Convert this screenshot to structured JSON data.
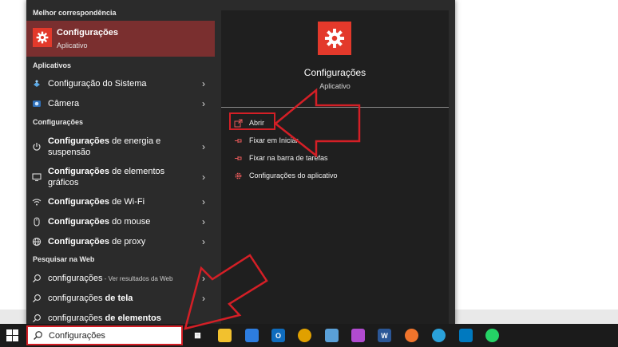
{
  "search_panel": {
    "best_match_label": "Melhor correspondência",
    "best_match": {
      "title": "Configurações",
      "subtitle": "Aplicativo",
      "icon": "gear-icon"
    },
    "apps_label": "Aplicativos",
    "apps": [
      {
        "label": "Configuração do Sistema",
        "icon": "system-config-icon"
      },
      {
        "label": "Câmera",
        "icon": "camera-icon"
      }
    ],
    "settings_label": "Configurações",
    "settings": [
      {
        "bold": "Configurações",
        "rest": " de energia e",
        "line2": "suspensão",
        "icon": "power-icon"
      },
      {
        "bold": "Configurações",
        "rest": " de elementos",
        "line2": "gráficos",
        "icon": "monitor-icon"
      },
      {
        "bold": "Configurações",
        "rest": " de Wi-Fi",
        "line2": "",
        "icon": "wifi-icon"
      },
      {
        "bold": "Configurações",
        "rest": " do mouse",
        "line2": "",
        "icon": "mouse-icon"
      },
      {
        "bold": "Configurações",
        "rest": " de proxy",
        "line2": "",
        "icon": "globe-icon"
      }
    ],
    "web_label": "Pesquisar na Web",
    "web": [
      {
        "normal": "configurações",
        "bold": "",
        "muted": " - Ver resultados da Web",
        "icon": "search-icon"
      },
      {
        "normal": "configurações ",
        "bold": "de tela",
        "muted": "",
        "icon": "search-icon"
      },
      {
        "normal": "configurações ",
        "bold": "de elementos",
        "muted": "",
        "icon": "search-icon"
      }
    ]
  },
  "detail": {
    "title": "Configurações",
    "subtitle": "Aplicativo",
    "actions": [
      {
        "label": "Abrir",
        "icon": "open-icon"
      },
      {
        "label": "Fixar em Iniciar",
        "icon": "pin-icon"
      },
      {
        "label": "Fixar na barra de tarefas",
        "icon": "pin-icon"
      },
      {
        "label": "Configurações do aplicativo",
        "icon": "gear-icon"
      }
    ]
  },
  "taskbar": {
    "search_value": "Configurações",
    "icons": [
      {
        "name": "task-view-icon",
        "color": "#1b1b1b",
        "glyph": "▦"
      },
      {
        "name": "file-explorer-icon",
        "color": "#f2c12e",
        "glyph": ""
      },
      {
        "name": "microsoft-store-icon",
        "color": "#2d7de0",
        "glyph": ""
      },
      {
        "name": "outlook-icon",
        "color": "#0f6cbd",
        "glyph": "O"
      },
      {
        "name": "chrome-icon",
        "color": "#e0a000",
        "glyph": ""
      },
      {
        "name": "notepad-icon",
        "color": "#5aa0d8",
        "glyph": ""
      },
      {
        "name": "drop-app-icon",
        "color": "#b14bd0",
        "glyph": ""
      },
      {
        "name": "word-icon",
        "color": "#2b5797",
        "glyph": "W"
      },
      {
        "name": "firefox-icon",
        "color": "#f0742c",
        "glyph": ""
      },
      {
        "name": "telegram-icon",
        "color": "#2aa1da",
        "glyph": ""
      },
      {
        "name": "trello-icon",
        "color": "#0079bf",
        "glyph": ""
      },
      {
        "name": "whatsapp-icon",
        "color": "#25d366",
        "glyph": ""
      }
    ]
  },
  "colors": {
    "accent_red": "#d41f26",
    "tile_red": "#e3392b",
    "panel": "#2b2b2b",
    "detail": "#1f1f1f",
    "highlight": "#7a2f2f"
  }
}
